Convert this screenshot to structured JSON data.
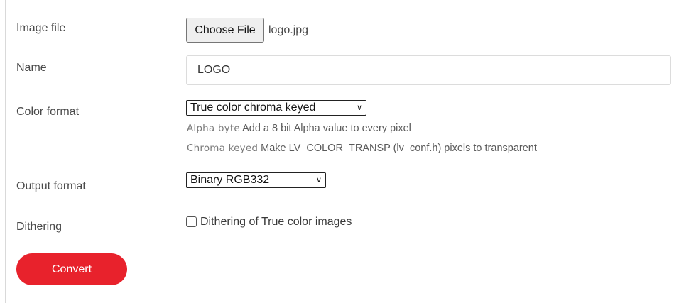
{
  "form": {
    "image_file": {
      "label": "Image file",
      "button_label": "Choose File",
      "file_name": "logo.jpg"
    },
    "name": {
      "label": "Name",
      "value": "LOGO"
    },
    "color_format": {
      "label": "Color format",
      "selected": "True color chroma keyed",
      "help": [
        {
          "key": "Alpha byte",
          "text": "Add a 8 bit Alpha value to every pixel"
        },
        {
          "key": "Chroma keyed",
          "text": "Make LV_COLOR_TRANSP (lv_conf.h) pixels to transparent"
        }
      ]
    },
    "output_format": {
      "label": "Output format",
      "selected": "Binary RGB332"
    },
    "dithering": {
      "label": "Dithering",
      "checkbox_label": "Dithering of True color images",
      "checked": false
    },
    "convert_label": "Convert"
  },
  "colors": {
    "convert_button": "#e8222c"
  }
}
